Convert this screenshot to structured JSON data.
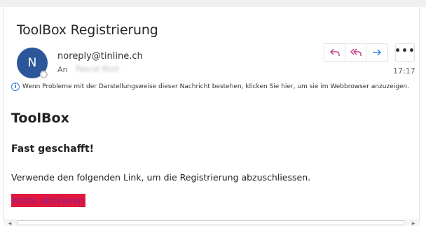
{
  "email": {
    "subject": "ToolBox Registrierung",
    "avatar_initial": "N",
    "sender": "noreply@tinline.ch",
    "to_label": "An",
    "to_value": "Pascal Rüst",
    "time": "17:17",
    "info_text": "Wenn Probleme mit der Darstellungsweise dieser Nachricht bestehen, klicken Sie hier, um sie im Webbrowser anzuzeigen."
  },
  "actions": {
    "reply_icon": "reply-icon",
    "reply_all_icon": "reply-all-icon",
    "forward_icon": "forward-icon",
    "more_label": "•••"
  },
  "body": {
    "heading": "ToolBox",
    "subheading": "Fast geschafft!",
    "text": "Verwende den folgenden Link, um die Registrierung abzuschliessen.",
    "link_label": "Konto aktivieren"
  },
  "colors": {
    "avatar": "#2b579a",
    "action_accent": "#c43e8a",
    "link_bg": "#e0173e",
    "link_text": "#8b1f8d"
  }
}
